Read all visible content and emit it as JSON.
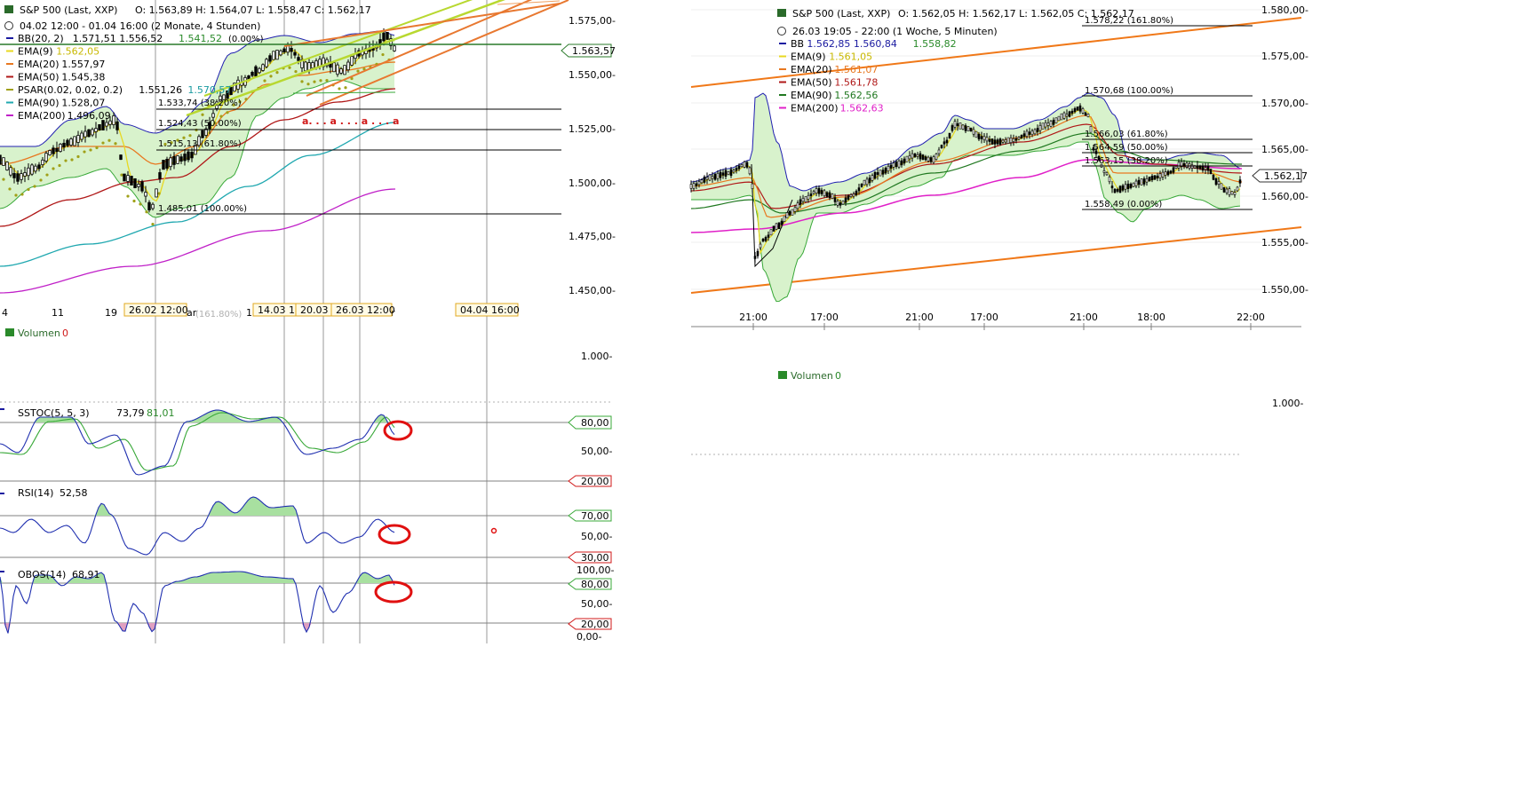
{
  "left_chart": {
    "header": {
      "title": "S&P 500 (Last, XXP)",
      "ohlc": "O: 1.563,89  H: 1.564,07  L: 1.558,47  C: 1.562,17",
      "range": "04.02 12:00 - 01.04 16:00 (2 Monate, 4 Stunden)"
    },
    "legend": [
      {
        "label": "BB(20, 2)",
        "values": "1.571,51  1.556,52",
        "extra": "1.541,52",
        "extra2": "(0.00%)",
        "color": "#1a1aa0"
      },
      {
        "label": "EMA(9)",
        "values": "1.562,05",
        "color": "#e8d820"
      },
      {
        "label": "EMA(20)",
        "values": "1.557,97",
        "color": "#e87820"
      },
      {
        "label": "EMA(50)",
        "values": "1.545,38",
        "color": "#b01818"
      },
      {
        "label": "PSAR(0.02, 0.02, 0.2)",
        "values": "1.551,26",
        "extra": "1.570,57",
        "color": "#a0a018"
      },
      {
        "label": "EMA(90)",
        "values": "1.528,07",
        "color": "#20a8b0"
      },
      {
        "label": "EMA(200)",
        "values": "1.496,09",
        "color": "#c020c8"
      }
    ],
    "y_ticks": [
      "1.575,00-",
      "1.550,00-",
      "1.525,00-",
      "1.500,00-",
      "1.475,00-",
      "1.450,00-"
    ],
    "x_ticks": [
      "4",
      "11",
      "19",
      "ar",
      "11",
      "r"
    ],
    "date_boxes": [
      "26.02 12:00",
      "14.03 16",
      "20.03 1",
      "26.03 12:00",
      "04.04 16:00"
    ],
    "fib_labels": [
      "1.533,74 (38.20%)",
      "1.524,43 (50.00%)",
      "1.515,13 (61.80%)",
      "1.485,01 (100.00%)",
      "(161.80%)"
    ],
    "last_price": "1.563,57",
    "annotation": "a. . . a . . . a . . . a",
    "volume": {
      "label": "Volumen",
      "value": "0",
      "tick": "1.000-"
    },
    "sstoc": {
      "label": "SSTOC(5, 5, 3)",
      "v1": "73,79",
      "v2": "81,01",
      "ticks": [
        "80,00",
        "50,00-",
        "20,00"
      ]
    },
    "rsi": {
      "label": "RSI(14)",
      "value": "52,58",
      "ticks": [
        "70,00",
        "50,00-",
        "30,00"
      ]
    },
    "obos": {
      "label": "OBOS(14)",
      "value": "68,91",
      "ticks": [
        "100,00-",
        "80,00",
        "50,00-",
        "20,00",
        "0,00-"
      ]
    }
  },
  "right_chart": {
    "header": {
      "title": "S&P 500 (Last, XXP)",
      "ohlc": "O: 1.562,05  H: 1.562,17  L: 1.562,05  C: 1.562,17",
      "range": "26.03 19:05 - 22:00 (1 Woche, 5 Minuten)"
    },
    "legend": [
      {
        "label": "BB",
        "values": "1.562,85  1.560,84",
        "extra": "1.558,82",
        "color": "#1a1aa0"
      },
      {
        "label": "EMA(9)",
        "values": "1.561,05",
        "color": "#e8d820"
      },
      {
        "label": "EMA(20)",
        "values": "1.561,07",
        "color": "#e87820"
      },
      {
        "label": "EMA(50)",
        "values": "1.561,78",
        "color": "#b01818"
      },
      {
        "label": "EMA(90)",
        "values": "1.562,56",
        "color": "#207820"
      },
      {
        "label": "EMA(200)",
        "values": "1.562,63",
        "color": "#e020c8"
      }
    ],
    "y_ticks": [
      "1.580,00-",
      "1.575,00-",
      "1.570,00-",
      "1.565,00-",
      "1.560,00-",
      "1.555,00-",
      "1.550,00-"
    ],
    "x_ticks": [
      "21:00",
      "17:00",
      "21:00",
      "17:00",
      "21:00",
      "18:00",
      "22:00"
    ],
    "fib_labels": [
      "1.578,22 (161.80%)",
      "1.570,68 (100.00%)",
      "1.566,03 (61.80%)",
      "1.564,59 (50.00%)",
      "1.563,15 (38.20%)",
      "1.558,49 (0.00%)"
    ],
    "last_price": "1.562,17",
    "volume": {
      "label": "Volumen",
      "value": "0",
      "tick": "1.000-"
    }
  },
  "chart_data": [
    {
      "type": "line",
      "title": "S&P 500 (Last, XXP)",
      "ylim": [
        1450,
        1580
      ],
      "y_ticks": [
        1575,
        1550,
        1525,
        1500,
        1475,
        1450
      ],
      "fib_levels": [
        1533.74,
        1524.43,
        1515.13,
        1485.01
      ],
      "last_price": 1563.57
    },
    {
      "type": "line",
      "title": "S&P 500 (Last, XXP)",
      "ylim": [
        1548,
        1582
      ],
      "y_ticks": [
        1580,
        1575,
        1570,
        1565,
        1560,
        1555,
        1550
      ],
      "fib_levels": [
        1578.22,
        1570.68,
        1566.03,
        1564.59,
        1563.15,
        1558.49
      ],
      "last_price": 1562.17
    }
  ]
}
